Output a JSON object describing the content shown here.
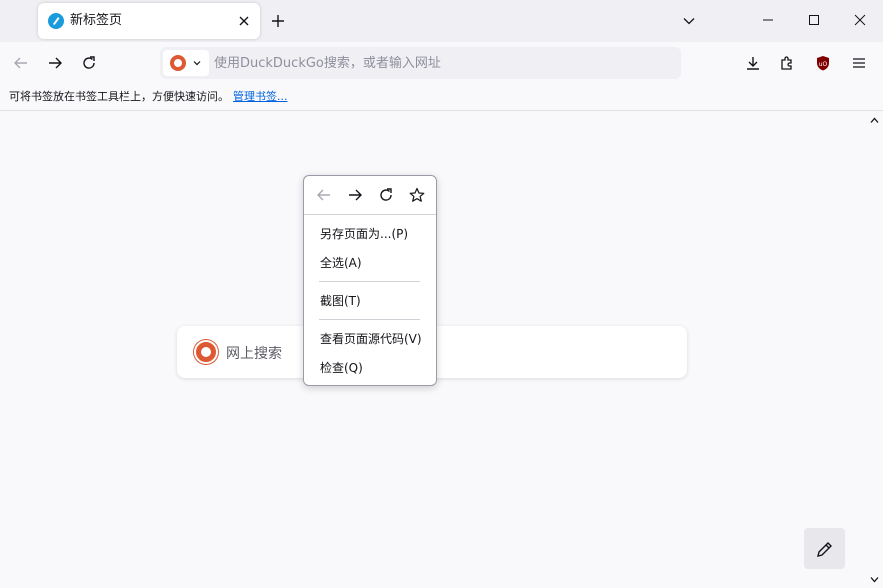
{
  "tab": {
    "title": "新标签页"
  },
  "toolbar": {
    "url_placeholder": "使用DuckDuckGo搜索，或者输入网址",
    "search_engine": "DuckDuckGo"
  },
  "bookmarks_bar": {
    "message": "可将书签放在书签工具栏上，方便快速访问。",
    "manage_link": "管理书签..."
  },
  "newtab": {
    "search_placeholder": "网上搜索"
  },
  "context_menu": {
    "items": [
      {
        "label": "另存页面为...(P)"
      },
      {
        "label": "全选(A)"
      },
      {
        "label": "截图(T)"
      },
      {
        "label": "查看页面源代码(V)"
      },
      {
        "label": "检查(Q)"
      }
    ]
  },
  "icons": {
    "back": "arrow-left-icon",
    "forward": "arrow-right-icon",
    "reload": "reload-icon",
    "bookmark": "star-icon",
    "downloads": "download-icon",
    "extensions": "puzzle-icon",
    "ublock": "ublock-shield-icon",
    "menu": "hamburger-menu-icon"
  },
  "colors": {
    "accent_link": "#0061e0",
    "ddg_orange": "#de5833",
    "ublock_red": "#800000"
  }
}
